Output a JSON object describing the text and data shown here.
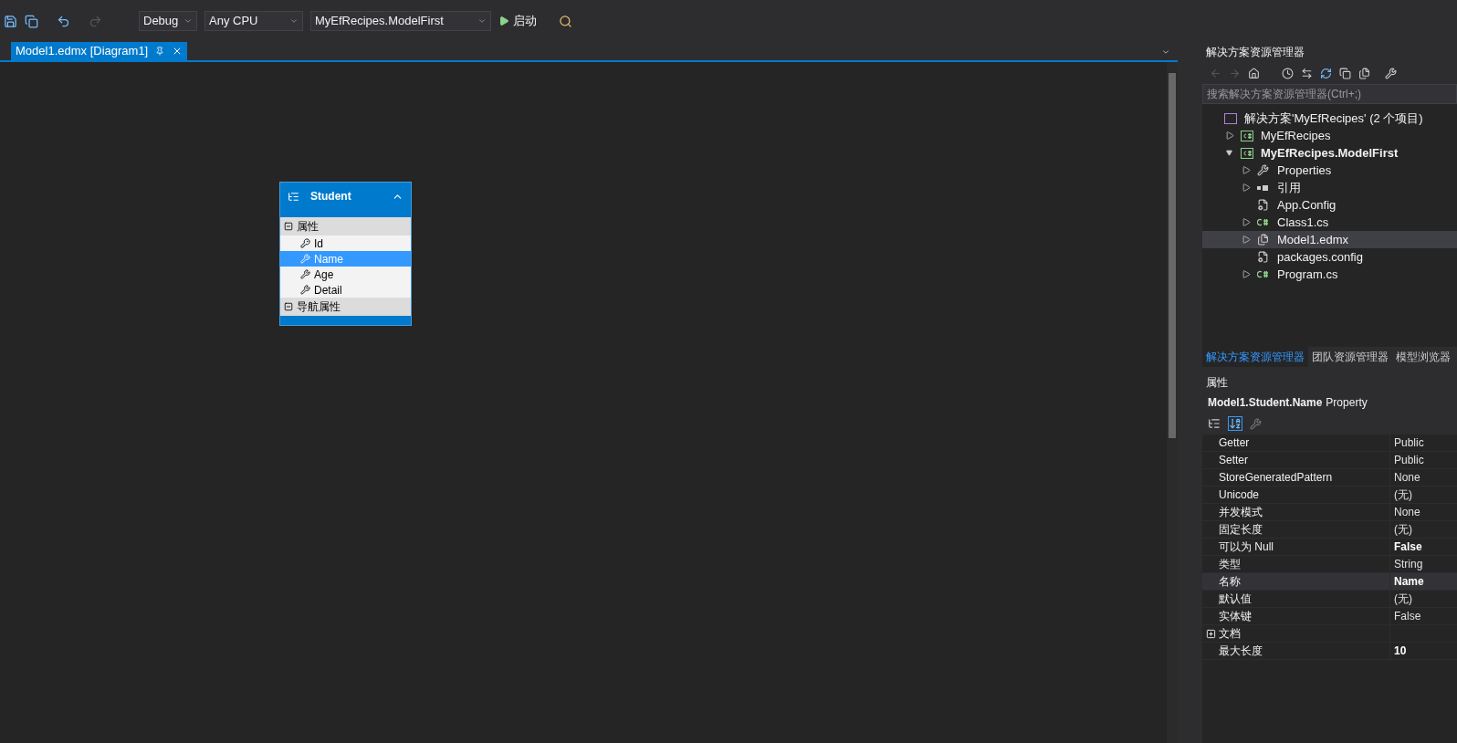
{
  "toolbar": {
    "config": "Debug",
    "platform": "Any CPU",
    "startup_project": "MyEfRecipes.ModelFirst",
    "start_label": "启动"
  },
  "tabs": [
    {
      "label": "Model1.edmx [Diagram1]",
      "selected": true
    }
  ],
  "entity": {
    "name": "Student",
    "sections": [
      {
        "label": "属性",
        "expanded": true,
        "properties": [
          {
            "name": "Id",
            "kind": "key",
            "selected": false
          },
          {
            "name": "Name",
            "kind": "scalar",
            "selected": true
          },
          {
            "name": "Age",
            "kind": "scalar",
            "selected": false
          },
          {
            "name": "Detail",
            "kind": "scalar",
            "selected": false
          }
        ]
      },
      {
        "label": "导航属性",
        "expanded": true
      }
    ]
  },
  "solution_explorer": {
    "title": "解决方案资源管理器",
    "search": {
      "placeholder": "搜索解决方案资源管理器(Ctrl+;)"
    },
    "tree": [
      {
        "label": "解决方案'MyEfRecipes' (2 个项目)",
        "kind": "solution",
        "bold": false,
        "selected": false,
        "children": [
          {
            "label": "MyEfRecipes",
            "kind": "project",
            "bold": false,
            "selected": false,
            "expanded": false
          },
          {
            "label": "MyEfRecipes.ModelFirst",
            "kind": "project",
            "bold": true,
            "selected": false,
            "expanded": true,
            "children": [
              {
                "label": "Properties",
                "kind": "wrench",
                "bold": false,
                "selected": false,
                "expanded": false
              },
              {
                "label": "引用",
                "kind": "references",
                "bold": false,
                "selected": false,
                "expanded": false
              },
              {
                "label": "App.Config",
                "kind": "config",
                "bold": false,
                "selected": false
              },
              {
                "label": "Class1.cs",
                "kind": "csharp",
                "bold": false,
                "selected": false,
                "expanded": false
              },
              {
                "label": "Model1.edmx",
                "kind": "edmx",
                "bold": false,
                "selected": true,
                "expanded": false
              },
              {
                "label": "packages.config",
                "kind": "config",
                "bold": false,
                "selected": false
              },
              {
                "label": "Program.cs",
                "kind": "csharp",
                "bold": false,
                "selected": false,
                "expanded": false
              }
            ]
          }
        ]
      }
    ],
    "tabs": [
      {
        "label": "解决方案资源管理器",
        "selected": true
      },
      {
        "label": "团队资源管理器",
        "selected": false
      },
      {
        "label": "模型浏览器",
        "selected": false
      }
    ]
  },
  "properties_panel": {
    "title": "属性",
    "object_name": "Model1.Student.Name",
    "object_type": "Property",
    "rows": [
      {
        "name": "Getter",
        "value": "Public",
        "bold": false,
        "selected": false
      },
      {
        "name": "Setter",
        "value": "Public",
        "bold": false,
        "selected": false
      },
      {
        "name": "StoreGeneratedPattern",
        "value": "None",
        "bold": false,
        "selected": false
      },
      {
        "name": "Unicode",
        "value": "(无)",
        "bold": false,
        "selected": false
      },
      {
        "name": "并发模式",
        "value": "None",
        "bold": false,
        "selected": false
      },
      {
        "name": "固定长度",
        "value": "(无)",
        "bold": false,
        "selected": false
      },
      {
        "name": "可以为 Null",
        "value": "False",
        "bold": true,
        "selected": false
      },
      {
        "name": "类型",
        "value": "String",
        "bold": false,
        "selected": false
      },
      {
        "name": "名称",
        "value": "Name",
        "bold": true,
        "selected": true
      },
      {
        "name": "默认值",
        "value": "(无)",
        "bold": false,
        "selected": false
      },
      {
        "name": "实体键",
        "value": "False",
        "bold": false,
        "selected": false
      },
      {
        "name": "文档",
        "expandable": true,
        "selected": false
      },
      {
        "name": "最大长度",
        "value": "10",
        "bold": true,
        "selected": false
      }
    ]
  }
}
